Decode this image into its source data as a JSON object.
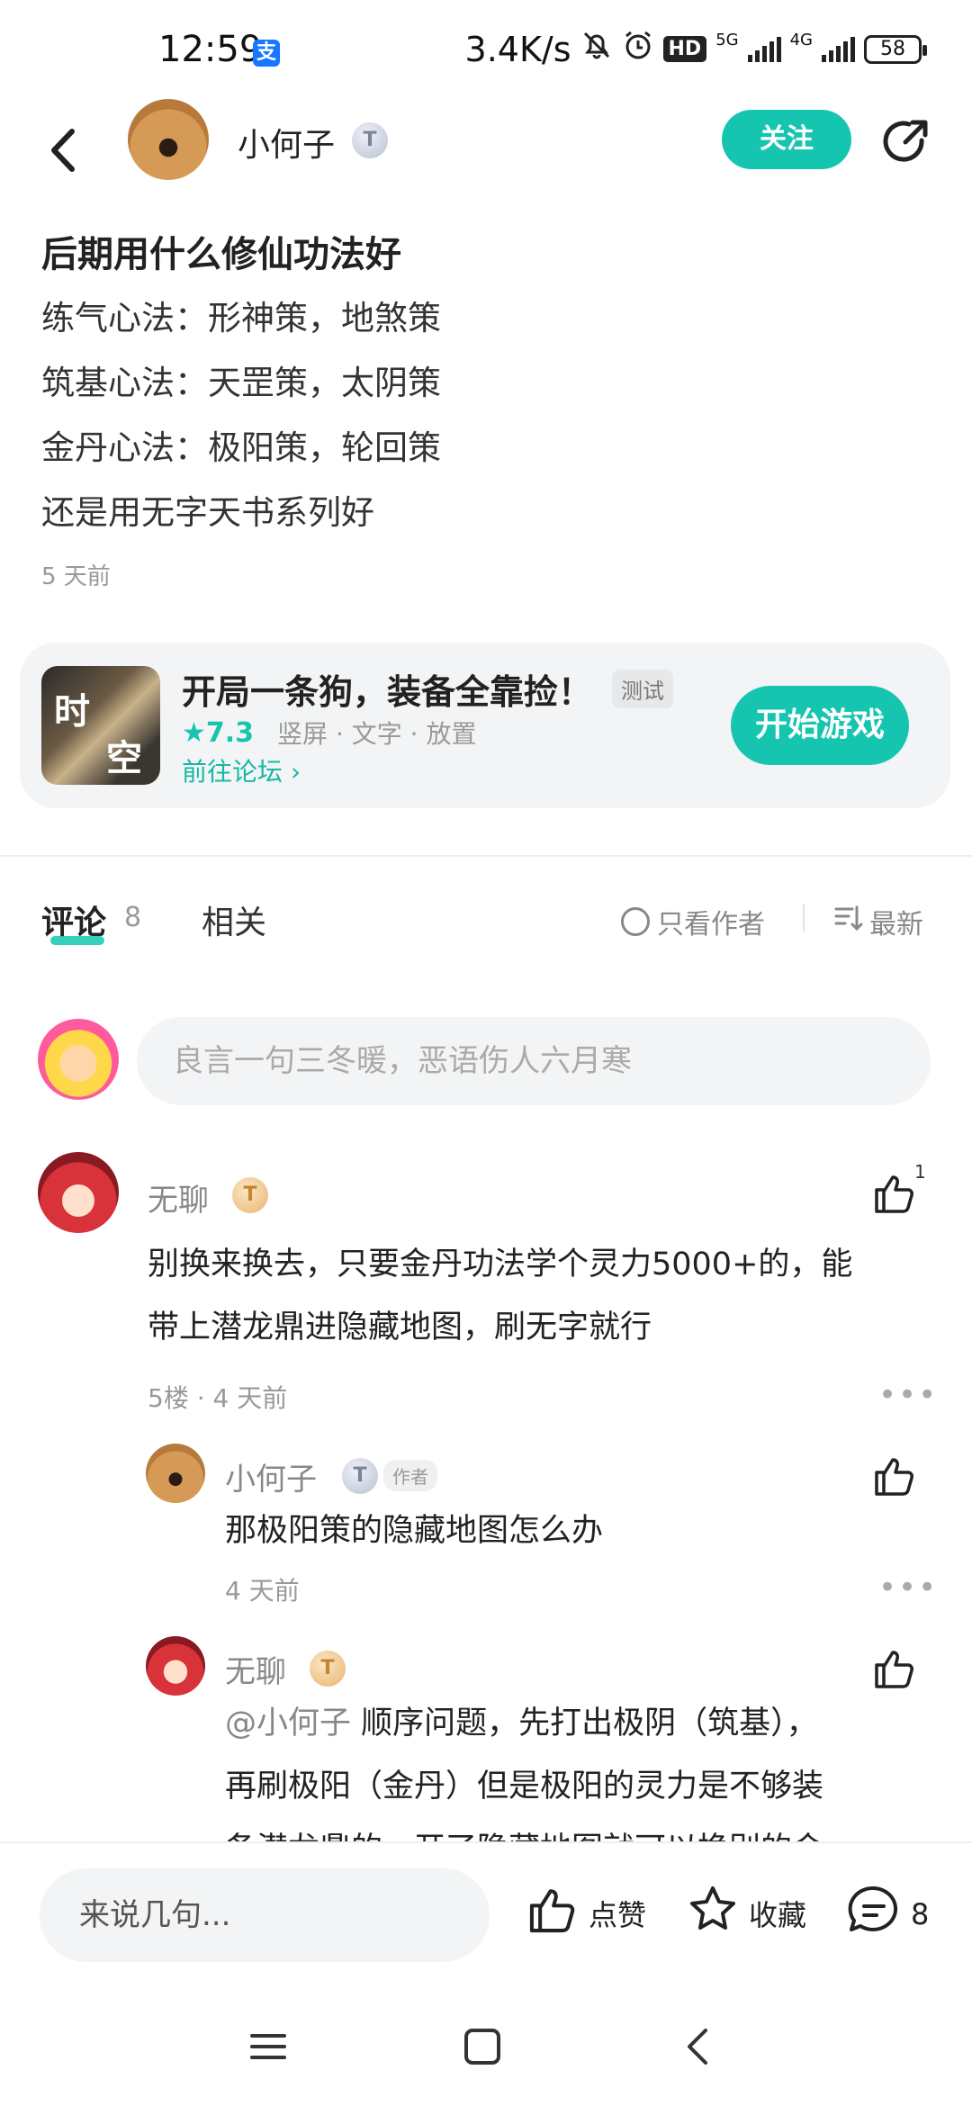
{
  "status_bar": {
    "time": "12:59",
    "alipay_icon": "支",
    "speed": "3.4K/s",
    "hd": "HD",
    "net1": "5G",
    "net2": "4G",
    "battery": "58"
  },
  "header": {
    "author_name": "小何子",
    "level_badge": "T",
    "follow_label": "关注"
  },
  "post": {
    "title": "后期用什么修仙功法好",
    "lines": [
      "练气心法：形神策，地煞策",
      "筑基心法：天罡策，太阴策",
      "金丹心法：极阳策，轮回策",
      "还是用无字天书系列好"
    ],
    "time": "5 天前"
  },
  "game_card": {
    "icon_chars": [
      "时",
      "空"
    ],
    "title": "开局一条狗，装备全靠捡！",
    "tag": "测试",
    "rating": "★7.3",
    "meta": "竖屏 · 文字 · 放置",
    "forum_link": "前往论坛 ›",
    "start_label": "开始游戏"
  },
  "tabs": {
    "comment_label": "评论",
    "comment_count": "8",
    "related_label": "相关",
    "only_author": "只看作者",
    "sort": "最新"
  },
  "comment_input": {
    "placeholder": "良言一句三冬暖，恶语伤人六月寒"
  },
  "comments": [
    {
      "name": "无聊",
      "badge": "T",
      "text_lines": [
        "别换来换去，只要金丹功法学个灵力5000+的，能",
        "带上潜龙鼎进隐藏地图，刷无字就行"
      ],
      "meta": "5楼 · 4 天前",
      "likes": "1",
      "replies": [
        {
          "name": "小何子",
          "badge": "T",
          "tag": "作者",
          "text": "那极阳策的隐藏地图怎么办",
          "meta": "4 天前"
        },
        {
          "name": "无聊",
          "badge": "T",
          "mention": "@小何子",
          "text_lines": [
            " 顺序问题，先打出极阴（筑基），",
            "再刷极阳（金丹）但是极阳的灵力是不够装",
            "备潜龙鼎的，开了隐藏地图就可以换别的金"
          ]
        }
      ]
    }
  ],
  "bottom_bar": {
    "reply_placeholder": "来说几句...",
    "like_label": "点赞",
    "collect_label": "收藏",
    "comment_count": "8"
  },
  "icons": {
    "back": "back-arrow-icon",
    "share": "share-icon",
    "like": "thumbs-up-icon",
    "collect": "star-icon",
    "comment": "comment-bubble-icon",
    "sort": "sort-icon",
    "nav_menu": "menu-icon",
    "nav_home": "home-square-icon",
    "nav_back": "back-triangle-icon"
  },
  "colors": {
    "accent": "#15c5b0",
    "text": "#222222",
    "muted": "#999999",
    "card_bg": "#f2f4f5"
  }
}
